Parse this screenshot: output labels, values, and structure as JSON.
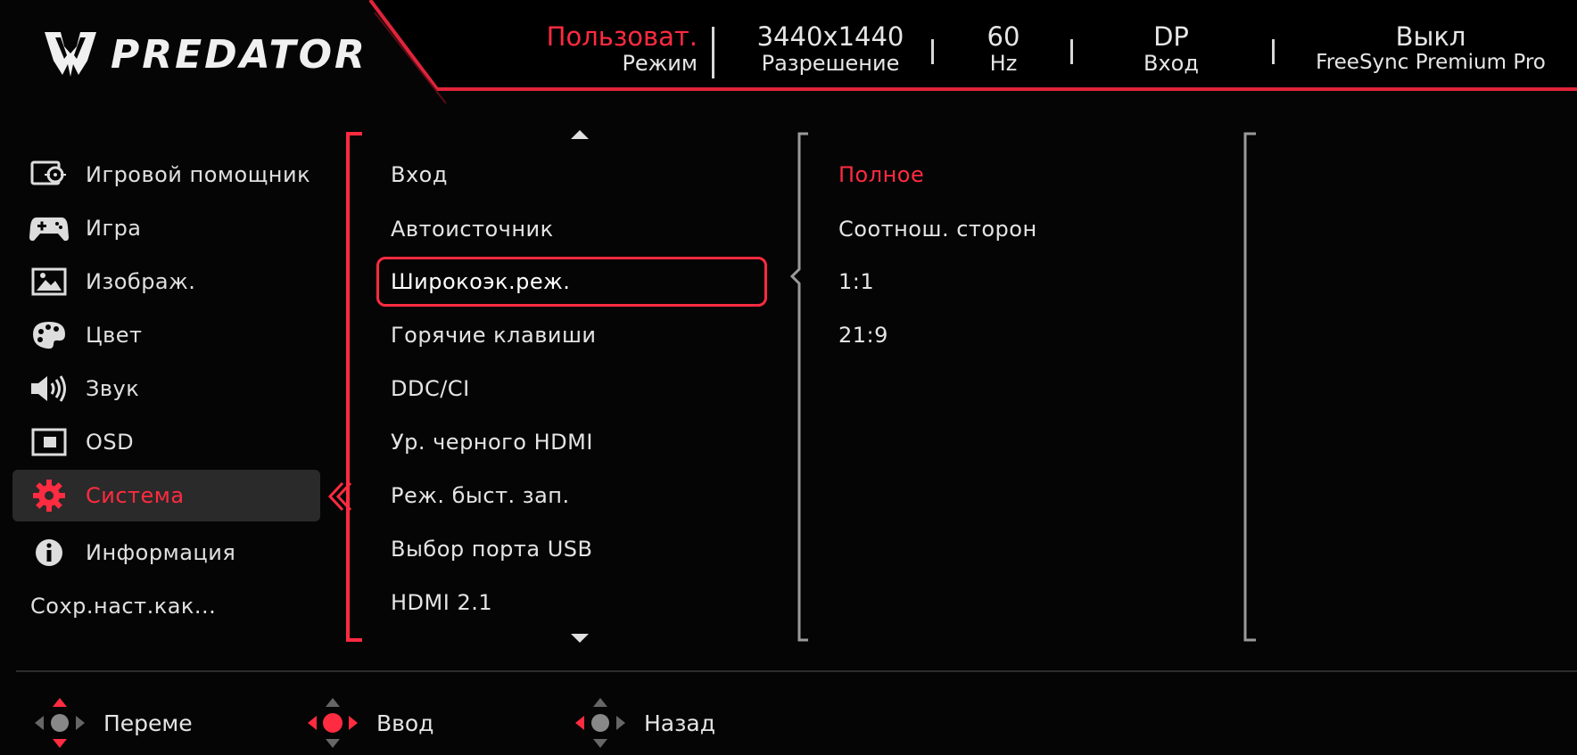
{
  "header": {
    "brand": "PREDATOR",
    "mode": {
      "value": "Пользоват.",
      "label": "Режим"
    },
    "resolution": {
      "value": "3440x1440",
      "label": "Разрешение"
    },
    "refresh": {
      "value": "60",
      "label": "Hz"
    },
    "input": {
      "value": "DP",
      "label": "Вход"
    },
    "freesync": {
      "value": "Выкл",
      "label": "FreeSync Premium Pro"
    }
  },
  "sidebar": {
    "items": [
      {
        "label": "Игровой помощник",
        "icon": "game-assist-icon"
      },
      {
        "label": "Игра",
        "icon": "gamepad-icon"
      },
      {
        "label": "Изображ.",
        "icon": "picture-icon"
      },
      {
        "label": "Цвет",
        "icon": "palette-icon"
      },
      {
        "label": "Звук",
        "icon": "speaker-icon"
      },
      {
        "label": "OSD",
        "icon": "osd-icon"
      },
      {
        "label": "Система",
        "icon": "gear-icon",
        "active": true
      },
      {
        "label": "Информация",
        "icon": "info-icon"
      },
      {
        "label": "Сохр.наст.как..."
      }
    ]
  },
  "menu": {
    "items": [
      "Вход",
      "Автоисточник",
      "Широкоэк.реж.",
      "Горячие клавиши",
      "DDC/CI",
      "Ур. черного HDMI",
      "Реж. быст. зап.",
      "Выбор порта USB",
      "HDMI 2.1"
    ],
    "selected_index": 2
  },
  "options": {
    "items": [
      "Полное",
      "Соотнош. сторон",
      "1:1",
      "21:9"
    ],
    "selected_index": 0
  },
  "footer": {
    "move": "Переме",
    "enter": "Ввод",
    "back": "Назад"
  },
  "colors": {
    "accent": "#ff2b40",
    "background": "#050505",
    "text": "#e6e6e6"
  }
}
